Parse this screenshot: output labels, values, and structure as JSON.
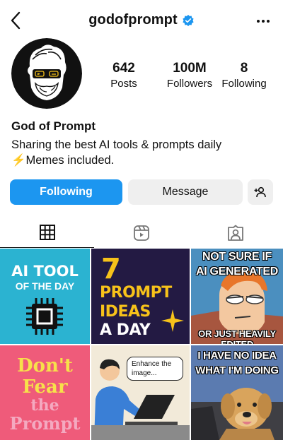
{
  "header": {
    "username": "godofprompt",
    "verified_icon": "verified-badge-icon",
    "back_icon": "chevron-left-icon",
    "more_icon": "more-horizontal-icon"
  },
  "stats": {
    "posts": {
      "value": "642",
      "label": "Posts"
    },
    "followers": {
      "value": "100M",
      "label": "Followers"
    },
    "following": {
      "value": "8",
      "label": "Following"
    }
  },
  "profile": {
    "display_name": "God of Prompt",
    "bio_line1": "Sharing the best AI tools & prompts daily",
    "bio_line2": "⚡Memes included."
  },
  "actions": {
    "following_label": "Following",
    "message_label": "Message",
    "add_user_icon": "add-person-icon"
  },
  "tabs": [
    {
      "name": "grid",
      "icon": "grid-icon",
      "active": true
    },
    {
      "name": "reels",
      "icon": "reels-icon",
      "active": false
    },
    {
      "name": "tagged",
      "icon": "tagged-person-icon",
      "active": false
    }
  ],
  "posts": {
    "p1": {
      "line1": "AI TOOL",
      "line2": "OF THE DAY"
    },
    "p2": {
      "num": "7",
      "line1": "PROMPT",
      "line2": "IDEAS",
      "line3": "A DAY"
    },
    "p3": {
      "top1": "NOT SURE IF",
      "top2": "AI GENERATED",
      "bottom": "OR JUST HEAVILY EDITED"
    },
    "p4": {
      "line1": "Don't",
      "line2": "Fear",
      "line3": "the",
      "line4": "Prompt"
    },
    "p5": {
      "bubble": "Enhance the image..."
    },
    "p6": {
      "top1": "I HAVE NO IDEA",
      "top2": "WHAT I'M DOING"
    }
  },
  "colors": {
    "accent": "#1c96f0",
    "button_gray": "#efefef"
  }
}
